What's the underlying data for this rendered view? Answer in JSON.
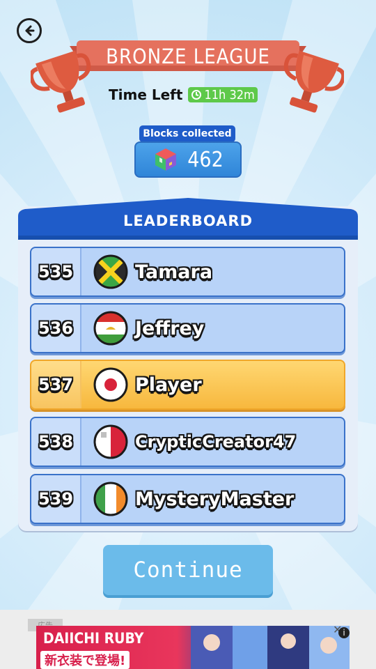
{
  "league": {
    "title": "BRONZE LEAGUE"
  },
  "timer": {
    "label": "Time Left",
    "value": "11h 32m",
    "icon": "clock-icon"
  },
  "blocks": {
    "label": "Blocks collected",
    "value": "462",
    "icon": "cube-icon"
  },
  "leaderboard": {
    "title": "LEADERBOARD",
    "rows": [
      {
        "rank": "535",
        "name": "Tamara",
        "flag": "jamaica-flag-icon"
      },
      {
        "rank": "536",
        "name": "Jeffrey",
        "flag": "tajikistan-flag-icon"
      },
      {
        "rank": "537",
        "name": "Player",
        "flag": "japan-flag-icon",
        "highlight": true
      },
      {
        "rank": "538",
        "name": "CrypticCreator47",
        "flag": "malta-flag-icon"
      },
      {
        "rank": "539",
        "name": "MysteryMaster",
        "flag": "ireland-flag-icon"
      }
    ]
  },
  "continue": {
    "label": "Continue"
  },
  "ad": {
    "tag": "広告",
    "title": "DAIICHI RUBY",
    "subtitle": "新衣装で登場!",
    "close": "✕",
    "info": "i"
  },
  "colors": {
    "banner": "#e5715e",
    "trophy": "#d9533a",
    "header_blue": "#1f5cc9",
    "row_blue": "#b8d3f8",
    "player_gold": "#f7b83e",
    "continue": "#6bbbea",
    "timer_green": "#5ec94a"
  }
}
